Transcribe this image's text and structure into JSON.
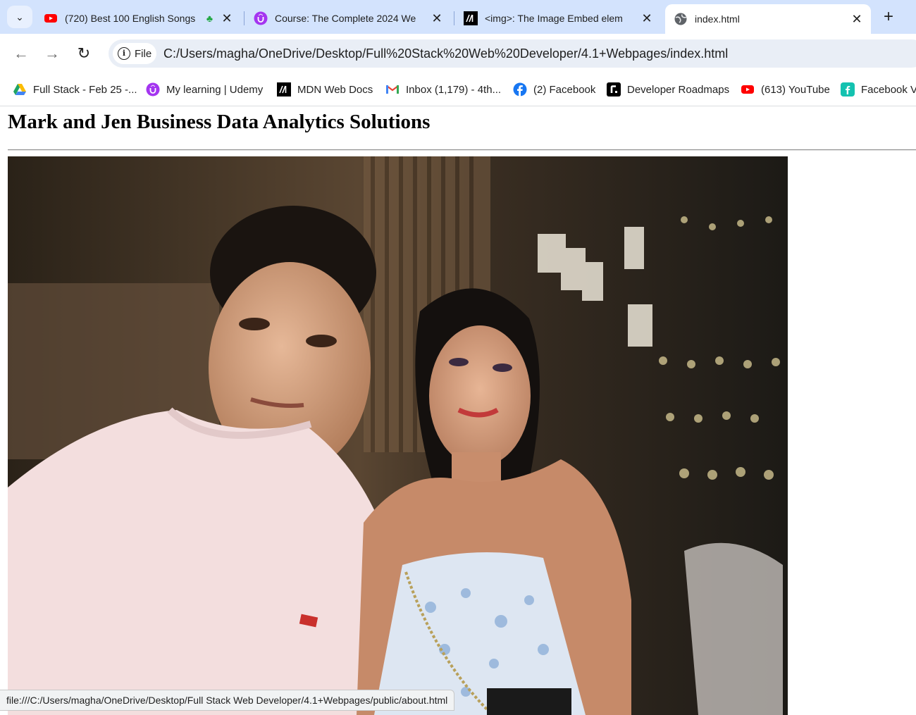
{
  "tabs": [
    {
      "title": "(720) Best 100 English Songs",
      "icon": "youtube-icon",
      "extra_icon": "shamrock-icon"
    },
    {
      "title": "Course: The Complete 2024 We",
      "icon": "udemy-icon"
    },
    {
      "title": "<img>: The Image Embed elem",
      "icon": "mdn-icon"
    },
    {
      "title": "index.html",
      "icon": "globe-icon",
      "active": true
    }
  ],
  "toolbar": {
    "chip_label": "File",
    "url": "C:/Users/magha/OneDrive/Desktop/Full%20Stack%20Web%20Developer/4.1+Webpages/index.html"
  },
  "bookmarks": [
    {
      "label": "Full Stack - Feb 25 -...",
      "icon": "google-drive-icon"
    },
    {
      "label": "My learning | Udemy",
      "icon": "udemy-icon"
    },
    {
      "label": "MDN Web Docs",
      "icon": "mdn-icon"
    },
    {
      "label": "Inbox (1,179) - 4th...",
      "icon": "gmail-icon"
    },
    {
      "label": "(2) Facebook",
      "icon": "facebook-icon"
    },
    {
      "label": "Developer Roadmaps",
      "icon": "roadmap-icon"
    },
    {
      "label": "(613) YouTube",
      "icon": "youtube-icon"
    },
    {
      "label": "Facebook Vi",
      "icon": "facebook-video-icon"
    }
  ],
  "page": {
    "heading": "Mark and Jen Business Data Analytics Solutions"
  },
  "status": {
    "link_url": "file:///C:/Users/magha/OneDrive/Desktop/Full Stack Web Developer/4.1+Webpages/public/about.html"
  },
  "colors": {
    "tab_strip": "#d3e3fd",
    "omnibox": "#e9eef6",
    "youtube_red": "#ff0000",
    "udemy_purple": "#a435f0",
    "facebook_blue": "#1877f2"
  }
}
